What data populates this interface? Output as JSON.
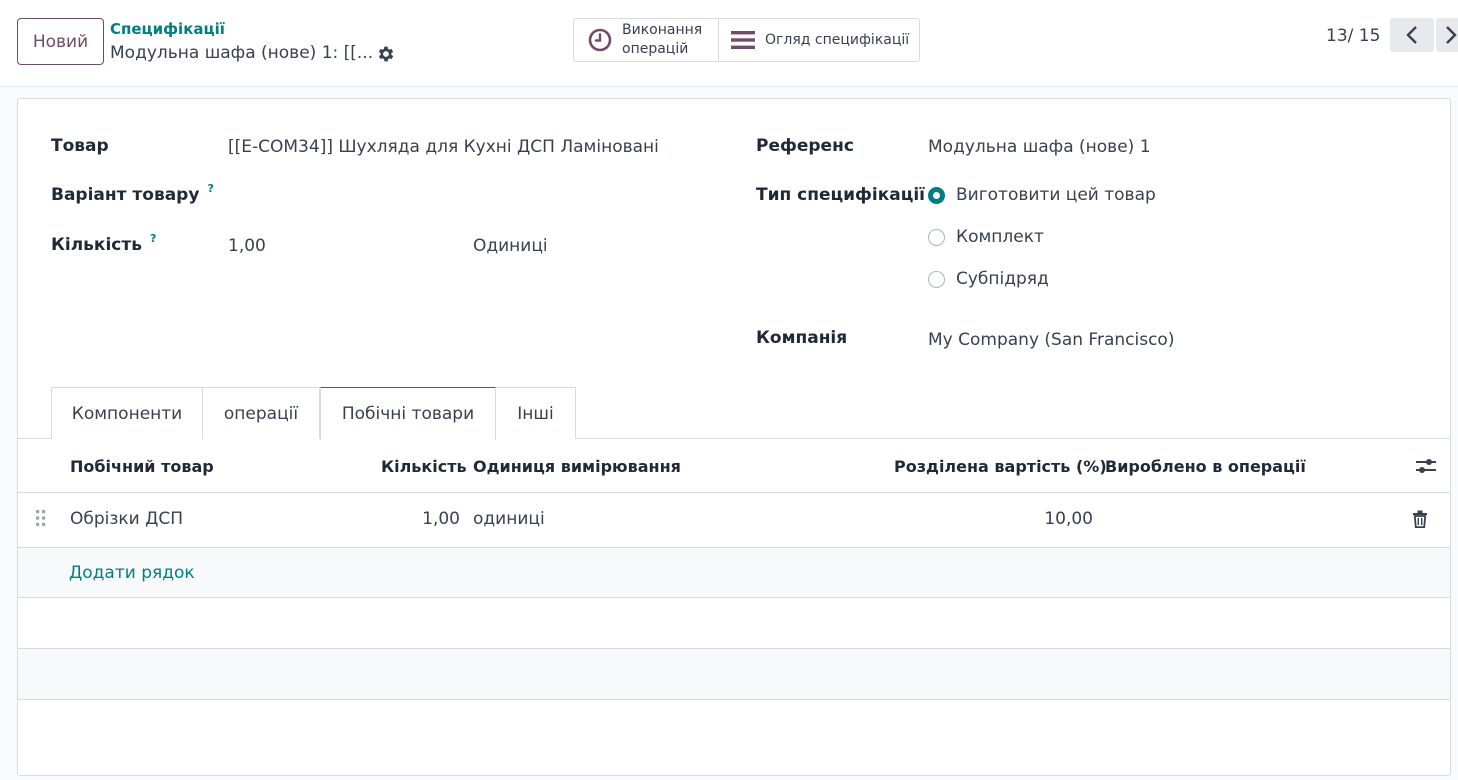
{
  "control_panel": {
    "new_button": "Новий",
    "breadcrumb_parent": "Специфікації",
    "breadcrumb_current": "Модульна шафа (нове) 1: [[...",
    "smart_buttons": {
      "operations_line1": "Виконання",
      "operations_line2": "операцій",
      "bom_overview": "Огляд специфікації"
    },
    "pager": "13/ 15"
  },
  "form": {
    "product_label": "Товар",
    "product_value": "[[E-COM34]] Шухляда для Кухні ДСП Ламіновані",
    "variant_label": "Варіант товару",
    "quantity_label": "Кількість",
    "quantity_value": "1,00",
    "quantity_uom": "Одиниці",
    "reference_label": "Референс",
    "reference_value": "Модульна шафа (нове) 1",
    "bom_type_label": "Тип специфікації",
    "bom_type_options": [
      "Виготовити цей товар",
      "Комплект",
      "Субпідряд"
    ],
    "company_label": "Компанія",
    "company_value": "My Company (San Francisco)",
    "help_mark": "?"
  },
  "tabs": [
    "Компоненти",
    "операції",
    "Побічні товари",
    "Інші"
  ],
  "byproducts": {
    "headers": [
      "Побічний товар",
      "Кількість",
      "Одиниця вимірювання",
      "Розділена вартість (%)",
      "Вироблено в операції"
    ],
    "rows": [
      {
        "product": "Обрізки ДСП",
        "quantity": "1,00",
        "uom": "одиниці",
        "cost_share": "10,00",
        "operation": ""
      }
    ],
    "add_line": "Додати рядок"
  },
  "colors": {
    "brand": "#714b67",
    "accent": "#017e84"
  }
}
